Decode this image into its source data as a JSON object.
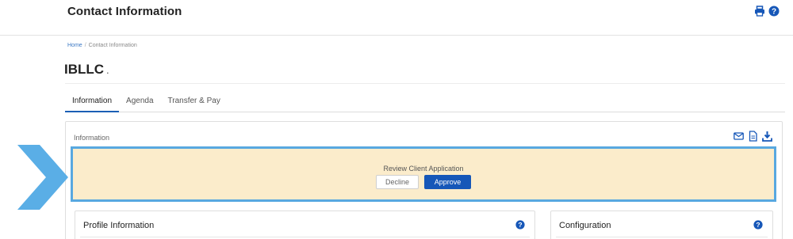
{
  "header": {
    "title": "Contact Information",
    "icons": [
      "print-icon",
      "help-icon"
    ]
  },
  "breadcrumb": {
    "home": "Home",
    "separator": "/",
    "current": "Contact Information"
  },
  "page": {
    "title": "IBLLC",
    "title_suffix": "."
  },
  "tabs": [
    {
      "label": "Information",
      "active": true
    },
    {
      "label": "Agenda",
      "active": false
    },
    {
      "label": "Transfer & Pay",
      "active": false
    }
  ],
  "information_panel": {
    "title": "Information",
    "icons": [
      "email-icon",
      "document-icon",
      "download-icon"
    ],
    "review": {
      "label": "Review Client Application",
      "decline_label": "Decline",
      "approve_label": "Approve"
    }
  },
  "profile_card": {
    "title": "Profile Information",
    "icon": "help-icon"
  },
  "config_card": {
    "title": "Configuration",
    "icon": "help-icon"
  },
  "colors": {
    "primary": "#1657b8",
    "highlight_border": "#58a8e0",
    "review_background": "#fbeccb",
    "arrow": "#5aaee6"
  }
}
